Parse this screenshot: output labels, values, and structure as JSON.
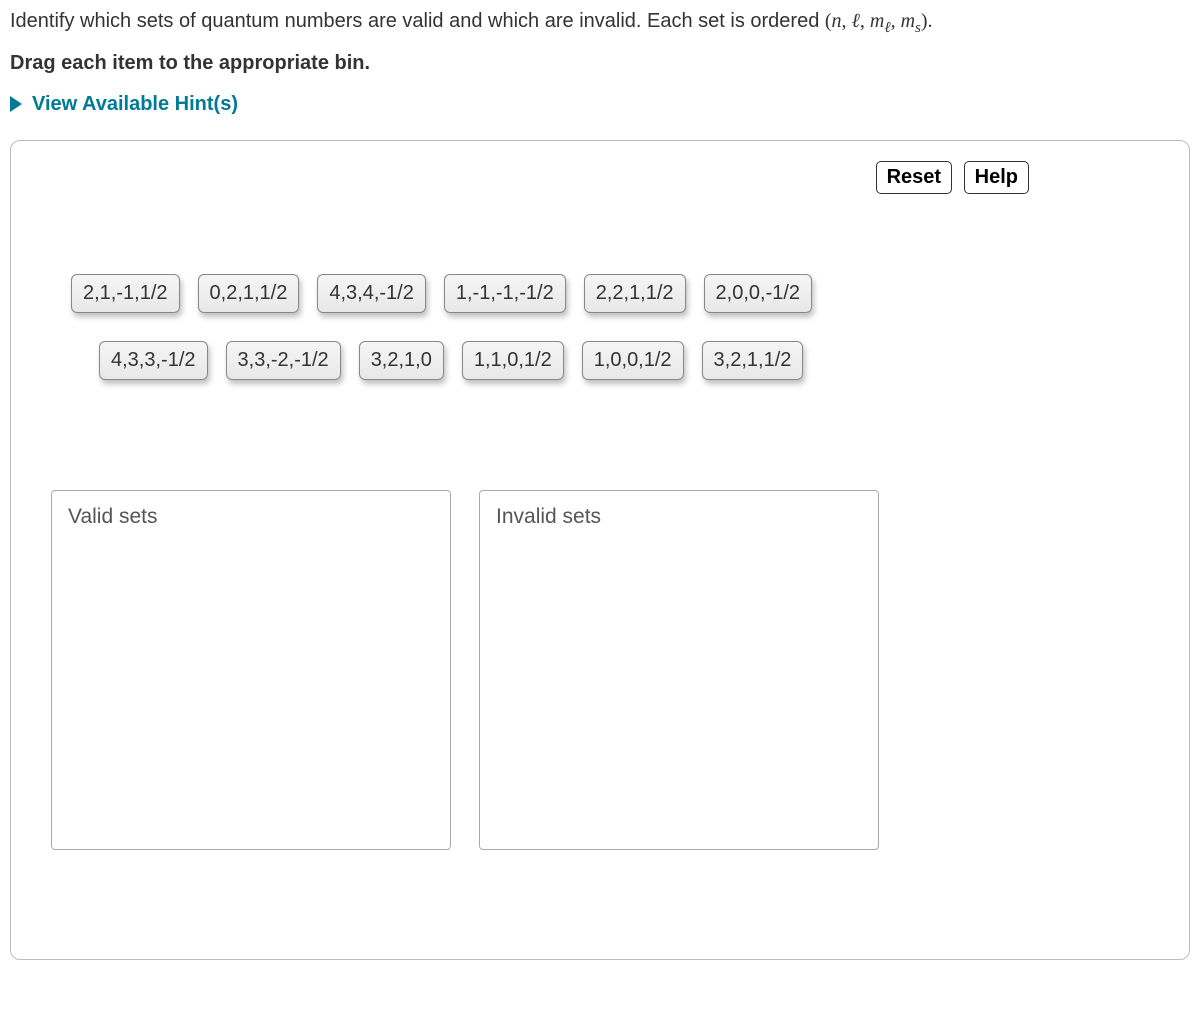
{
  "question": {
    "prefix": "Identify which sets of quantum numbers are valid and which are invalid. Each set is ordered ",
    "ordered_open": "(",
    "n": "n",
    "sep1": ", ",
    "l": "ℓ",
    "sep2": ", ",
    "m": "m",
    "ml_sub": "ℓ",
    "sep3": ", ",
    "m2": "m",
    "ms_sub": "s",
    "ordered_close": ").",
    "instruction": "Drag each item to the appropriate bin."
  },
  "hints": {
    "toggle_label": "View Available Hint(s)"
  },
  "buttons": {
    "reset": "Reset",
    "help": "Help"
  },
  "items_row1": [
    "2,1,-1,1/2",
    "0,2,1,1/2",
    "4,3,4,-1/2",
    "1,-1,-1,-1/2",
    "2,2,1,1/2",
    "2,0,0,-1/2"
  ],
  "items_row2": [
    "4,3,3,-1/2",
    "3,3,-2,-1/2",
    "3,2,1,0",
    "1,1,0,1/2",
    "1,0,0,1/2",
    "3,2,1,1/2"
  ],
  "bins": {
    "valid": "Valid sets",
    "invalid": "Invalid sets"
  }
}
